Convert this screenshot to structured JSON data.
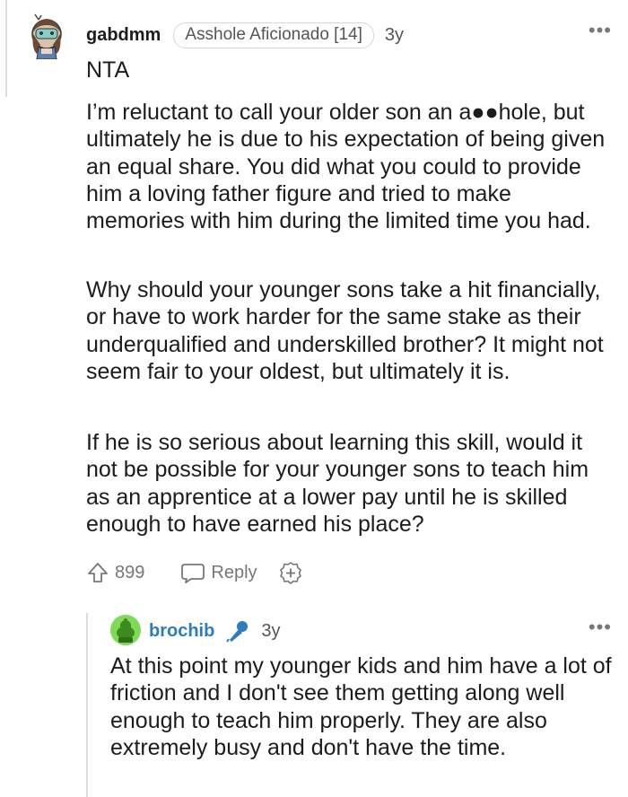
{
  "comment": {
    "username": "gabdmm",
    "flair": "Asshole Aficionado [14]",
    "timestamp": "3y",
    "more_label": "•••",
    "paragraphs": [
      "NTA",
      "I’m reluctant to call your older son an a●●hole, but ultimately he is due to his expectation of being given an equal share. You did what you could to provide him a loving father figure and tried to make memories with him during the limited time you had.",
      "Why should your younger sons take a hit financially, or have to work harder for the same stake as their underqualified and underskilled brother? It might not seem fair to your oldest, but ultimately it is.",
      "If he is so serious about learning this skill, would it not be possible for your younger sons to teach him as an apprentice at a lower pay until he is skilled enough to have earned his place?"
    ],
    "upvote_count": "899",
    "reply_label": "Reply",
    "avatar_icon": "avatar-snoo-icon"
  },
  "reply": {
    "username": "brochib",
    "timestamp": "3y",
    "more_label": "•••",
    "op_icon": "microphone-icon",
    "text": "At this point my younger kids and him have a lot of friction and I don't see them getting along well enough to teach him properly. They are also extremely busy and don't have the time.",
    "avatar_icon": "avatar-snoo-icon"
  },
  "colors": {
    "op_username": "#2c7cc0",
    "muted": "#777777",
    "thread_line": "#dddddd",
    "reply_avatar_bg": "#7ed957"
  }
}
